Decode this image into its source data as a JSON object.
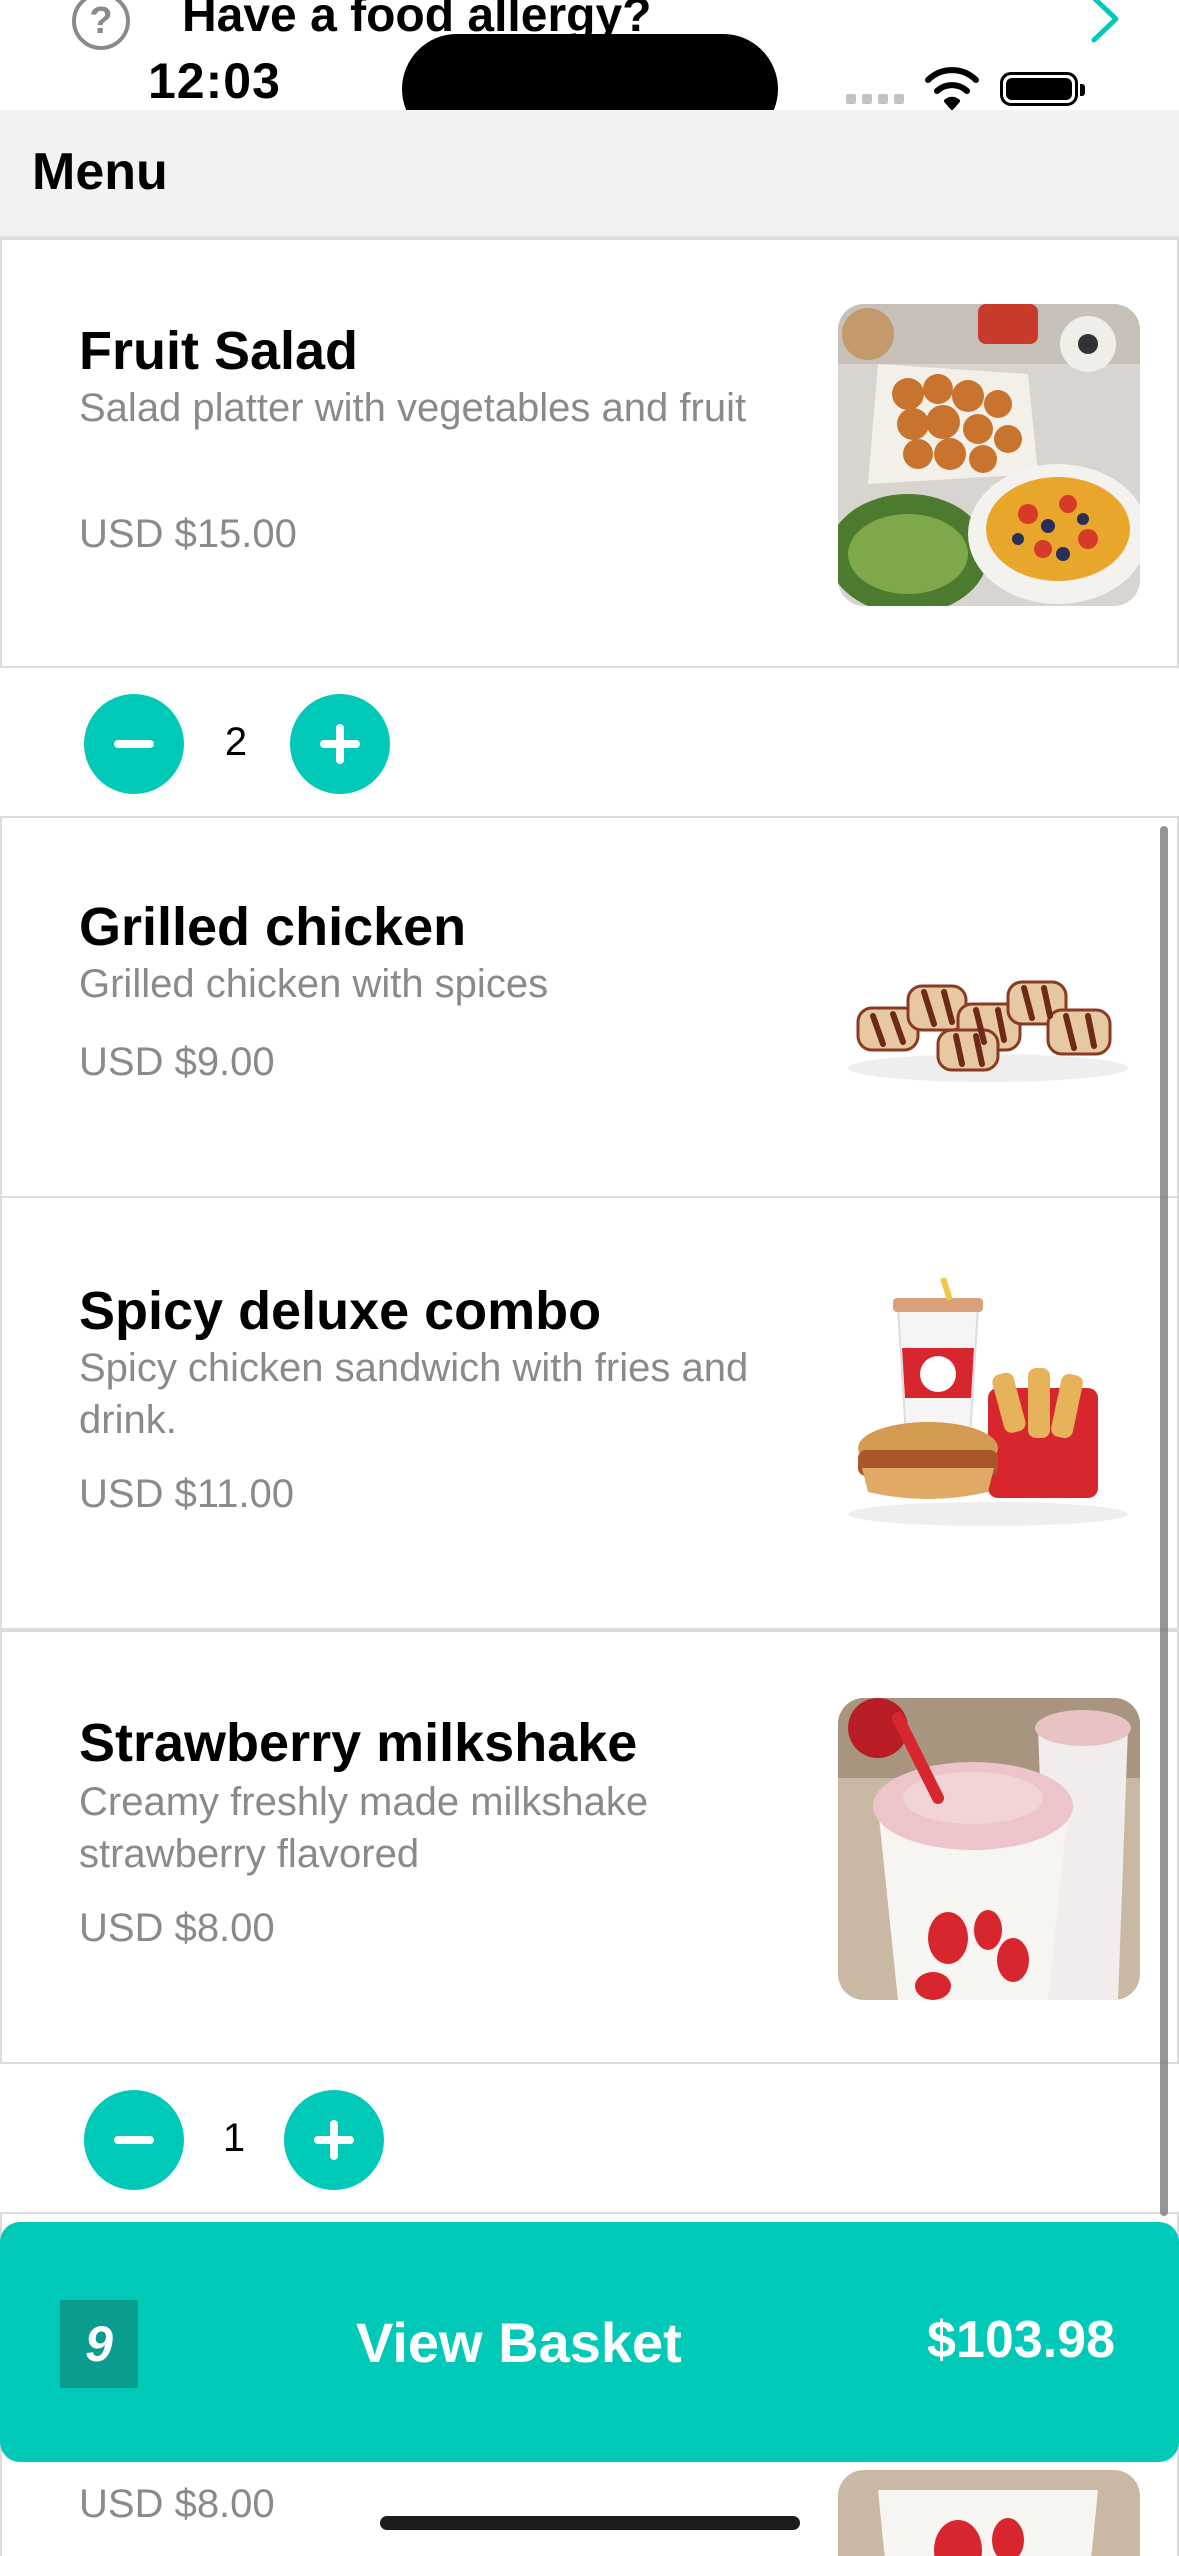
{
  "top_row": {
    "title": "Have a food allergy?",
    "icon": "help-icon",
    "chevron": "chevron-right-icon"
  },
  "status_bar": {
    "time": "12:03"
  },
  "menu": {
    "title": "Menu"
  },
  "items": [
    {
      "name": "Fruit Salad",
      "description": "Salad platter with vegetables and fruit",
      "price": "USD $15.00",
      "quantity": "2"
    },
    {
      "name": "Grilled chicken",
      "description": "Grilled chicken with spices",
      "price": "USD $9.00"
    },
    {
      "name": "Spicy deluxe combo",
      "description": "Spicy chicken sandwich with fries and drink.",
      "price": "USD $11.00"
    },
    {
      "name": "Strawberry milkshake",
      "description": "Creamy freshly made milkshake strawberry flavored",
      "price": "USD $8.00",
      "quantity": "1"
    },
    {
      "price": "USD $8.00"
    }
  ],
  "basket": {
    "count": "9",
    "label": "View Basket",
    "total": "$103.98"
  },
  "colors": {
    "accent": "#00c9b7",
    "accent_dark": "#0a9c8f",
    "muted_text": "#8a8a8a"
  }
}
